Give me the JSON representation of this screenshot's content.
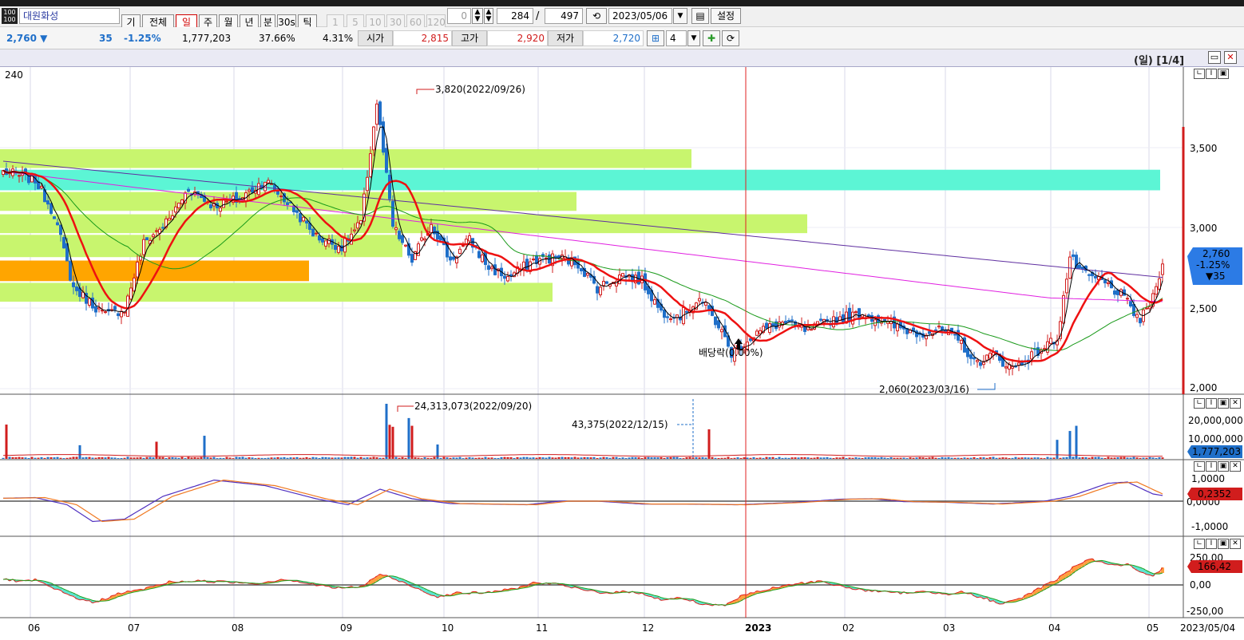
{
  "toolbar": {
    "stock_name": "대원화성",
    "buttons": [
      "기",
      "전체",
      "일",
      "주",
      "월",
      "년",
      "분",
      "30s",
      "틱"
    ],
    "active_button": "일",
    "period_buttons": [
      "1",
      "5",
      "10",
      "30",
      "60",
      "120"
    ],
    "interval_value": "0",
    "visible_count": "284",
    "separator": "/",
    "total_count": "497",
    "date": "2023/05/06",
    "settings_label": "설정"
  },
  "quote": {
    "price": "2,760 ▼",
    "change": "35",
    "change_rate": "-1.25%",
    "volume": "1,777,203",
    "ratio1": "37.66%",
    "ratio2": "4.31%",
    "open_label": "시가",
    "open": "2,815",
    "high_label": "고가",
    "high": "2,920",
    "low_label": "저가",
    "low": "2,720",
    "layout_value": "4"
  },
  "chart_header": {
    "page_label": "(일) [1/4]"
  },
  "colors": {
    "up": "#d11d1d",
    "down": "#1f6fc9",
    "ma5": "#000000",
    "ma20": "#ee1111",
    "ma60": "#1a9a1a",
    "ma120": "#e020e0",
    "ma240": "#6030a0",
    "zone_green": "#c8f56e",
    "zone_cyan": "#5cf5d5",
    "zone_orange": "#ffa500",
    "price_badge": "#2c7be5",
    "volume_badge": "#1f6fc9",
    "osc_badge": "#d11d1d"
  },
  "price_pane": {
    "ma_label": "240",
    "axis_ticks": [
      "3,500",
      "3,000",
      "2,500",
      "2,000"
    ],
    "current_badge": [
      "2,760",
      "-1.25%",
      "▼35"
    ],
    "high_annotation": "3,820(2022/09/26)",
    "low_annotation": "2,060(2023/03/16)",
    "dividend_annotation": "배당락(0.00%)"
  },
  "volume_pane": {
    "axis_ticks": [
      "20,000,000",
      "10,000,000"
    ],
    "current_badge": "1,777,203",
    "max_annotation": "24,313,073(2022/09/20)",
    "min_annotation": "43,375(2022/12/15)"
  },
  "macd_pane": {
    "axis_ticks": [
      "1,0000",
      "-1,0000"
    ],
    "zero_label": "0,0000",
    "current_badge": "0,2352"
  },
  "osc_pane": {
    "axis_ticks": [
      "250,00",
      "0,00",
      "-250,00"
    ],
    "current_badge": "166,42"
  },
  "x_axis": {
    "labels": [
      "06",
      "07",
      "08",
      "09",
      "10",
      "11",
      "12",
      "2023",
      "02",
      "03",
      "04",
      "05"
    ],
    "end_date": "2023/05/04"
  },
  "chart_data": {
    "type": "candlestick",
    "y_range": [
      2000,
      3900
    ],
    "price_zones": [
      {
        "from": 3320,
        "to": 3430,
        "color": "zone_green"
      },
      {
        "from": 3190,
        "to": 3310,
        "color": "zone_cyan"
      },
      {
        "from": 3070,
        "to": 3180,
        "color": "zone_green"
      },
      {
        "from": 2940,
        "to": 3050,
        "color": "zone_green"
      },
      {
        "from": 2800,
        "to": 2930,
        "color": "zone_green"
      },
      {
        "from": 2660,
        "to": 2780,
        "color": "zone_orange"
      },
      {
        "from": 2540,
        "to": 2650,
        "color": "zone_green"
      }
    ],
    "price_anchors": [
      [
        0,
        3300
      ],
      [
        10,
        3250
      ],
      [
        16,
        3050
      ],
      [
        22,
        2620
      ],
      [
        32,
        2460
      ],
      [
        38,
        2500
      ],
      [
        44,
        2880
      ],
      [
        52,
        3020
      ],
      [
        58,
        3200
      ],
      [
        66,
        3100
      ],
      [
        74,
        3140
      ],
      [
        82,
        3250
      ],
      [
        90,
        3100
      ],
      [
        98,
        2920
      ],
      [
        106,
        2860
      ],
      [
        112,
        3000
      ],
      [
        117,
        3700
      ],
      [
        122,
        2980
      ],
      [
        128,
        2780
      ],
      [
        134,
        3000
      ],
      [
        140,
        2780
      ],
      [
        146,
        2900
      ],
      [
        152,
        2740
      ],
      [
        158,
        2680
      ],
      [
        166,
        2780
      ],
      [
        174,
        2800
      ],
      [
        180,
        2760
      ],
      [
        186,
        2620
      ],
      [
        194,
        2700
      ],
      [
        200,
        2660
      ],
      [
        206,
        2480
      ],
      [
        212,
        2460
      ],
      [
        218,
        2560
      ],
      [
        224,
        2400
      ],
      [
        228,
        2240
      ],
      [
        236,
        2360
      ],
      [
        244,
        2420
      ],
      [
        252,
        2370
      ],
      [
        260,
        2440
      ],
      [
        270,
        2470
      ],
      [
        278,
        2400
      ],
      [
        286,
        2360
      ],
      [
        294,
        2370
      ],
      [
        300,
        2300
      ],
      [
        304,
        2180
      ],
      [
        310,
        2230
      ],
      [
        316,
        2150
      ],
      [
        324,
        2250
      ],
      [
        330,
        2330
      ],
      [
        334,
        2800
      ],
      [
        338,
        2700
      ],
      [
        344,
        2660
      ],
      [
        350,
        2580
      ],
      [
        356,
        2430
      ],
      [
        360,
        2560
      ],
      [
        363,
        2760
      ]
    ],
    "macd_anchors": [
      [
        0,
        0.12
      ],
      [
        10,
        0.15
      ],
      [
        20,
        -0.15
      ],
      [
        28,
        -0.85
      ],
      [
        38,
        -0.75
      ],
      [
        50,
        0.2
      ],
      [
        66,
        0.88
      ],
      [
        82,
        0.65
      ],
      [
        98,
        0.1
      ],
      [
        108,
        -0.15
      ],
      [
        118,
        0.5
      ],
      [
        128,
        0.1
      ],
      [
        140,
        -0.1
      ],
      [
        150,
        -0.12
      ],
      [
        164,
        -0.15
      ],
      [
        174,
        0.0
      ],
      [
        186,
        0.0
      ],
      [
        200,
        -0.12
      ],
      [
        212,
        -0.12
      ],
      [
        230,
        -0.15
      ],
      [
        248,
        -0.05
      ],
      [
        262,
        0.08
      ],
      [
        272,
        0.1
      ],
      [
        282,
        -0.02
      ],
      [
        296,
        -0.05
      ],
      [
        310,
        -0.12
      ],
      [
        326,
        0.0
      ],
      [
        334,
        0.2
      ],
      [
        346,
        0.75
      ],
      [
        352,
        0.8
      ],
      [
        360,
        0.3
      ],
      [
        363,
        0.2352
      ]
    ],
    "osc_anchors": [
      [
        0,
        60
      ],
      [
        6,
        30
      ],
      [
        10,
        50
      ],
      [
        16,
        -40
      ],
      [
        22,
        -120
      ],
      [
        28,
        -180
      ],
      [
        36,
        -90
      ],
      [
        44,
        -40
      ],
      [
        52,
        30
      ],
      [
        60,
        40
      ],
      [
        70,
        30
      ],
      [
        80,
        15
      ],
      [
        88,
        60
      ],
      [
        96,
        10
      ],
      [
        104,
        -30
      ],
      [
        112,
        -20
      ],
      [
        118,
        110
      ],
      [
        124,
        40
      ],
      [
        130,
        -40
      ],
      [
        136,
        -120
      ],
      [
        142,
        -80
      ],
      [
        150,
        -80
      ],
      [
        160,
        -40
      ],
      [
        166,
        20
      ],
      [
        172,
        15
      ],
      [
        180,
        -40
      ],
      [
        188,
        -80
      ],
      [
        194,
        -70
      ],
      [
        200,
        -80
      ],
      [
        206,
        -150
      ],
      [
        212,
        -130
      ],
      [
        220,
        -200
      ],
      [
        226,
        -200
      ],
      [
        232,
        -100
      ],
      [
        240,
        -40
      ],
      [
        248,
        10
      ],
      [
        256,
        40
      ],
      [
        264,
        -30
      ],
      [
        272,
        -60
      ],
      [
        280,
        -80
      ],
      [
        288,
        -70
      ],
      [
        296,
        -90
      ],
      [
        300,
        -60
      ],
      [
        304,
        -110
      ],
      [
        308,
        -140
      ],
      [
        312,
        -200
      ],
      [
        318,
        -140
      ],
      [
        324,
        -40
      ],
      [
        330,
        60
      ],
      [
        336,
        200
      ],
      [
        340,
        260
      ],
      [
        344,
        230
      ],
      [
        348,
        190
      ],
      [
        352,
        210
      ],
      [
        356,
        120
      ],
      [
        360,
        80
      ],
      [
        363,
        166.42
      ]
    ]
  }
}
